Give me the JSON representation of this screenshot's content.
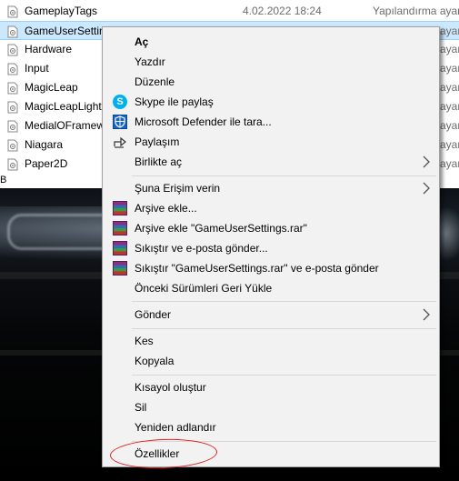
{
  "explorer": {
    "files": [
      {
        "name": "GameplayTags",
        "date": "4.02.2022 18:24",
        "type": "Yapılandırma ayar"
      },
      {
        "name": "GameUserSettin",
        "date": "",
        "type": "ayar"
      },
      {
        "name": "Hardware",
        "date": "",
        "type": "ayar"
      },
      {
        "name": "Input",
        "date": "",
        "type": "ayar"
      },
      {
        "name": "MagicLeap",
        "date": "",
        "type": "ayar"
      },
      {
        "name": "MagicLeapLight",
        "date": "",
        "type": "ayar"
      },
      {
        "name": "MedialOFramew",
        "date": "",
        "type": "ayar"
      },
      {
        "name": "Niagara",
        "date": "",
        "type": "ayar"
      },
      {
        "name": "Paper2D",
        "date": "",
        "type": "ayar"
      }
    ],
    "status_text": "B"
  },
  "context_menu": {
    "items": {
      "open": "Aç",
      "print": "Yazdır",
      "edit": "Düzenle",
      "skype": "Skype ile paylaş",
      "defender": "Microsoft Defender ile tara...",
      "share": "Paylaşım",
      "open_with": "Birlikte aç",
      "give_access": "Şuna Erişim verin",
      "add_archive": "Arşive ekle...",
      "add_archive_named": "Arşive ekle \"GameUserSettings.rar\"",
      "compress_email": "Sıkıştır ve e-posta gönder...",
      "compress_named_email": "Sıkıştır \"GameUserSettings.rar\" ve e-posta gönder",
      "restore_versions": "Önceki Sürümleri Geri Yükle",
      "send_to": "Gönder",
      "cut": "Kes",
      "copy": "Kopyala",
      "create_shortcut": "Kısayol oluştur",
      "delete": "Sil",
      "rename": "Yeniden adlandır",
      "properties": "Özellikler"
    },
    "icons": {
      "skype": "S"
    }
  },
  "colors": {
    "selection": "#cce8ff",
    "menu_bg": "#f2f2f2",
    "annotation": "#e02020"
  }
}
